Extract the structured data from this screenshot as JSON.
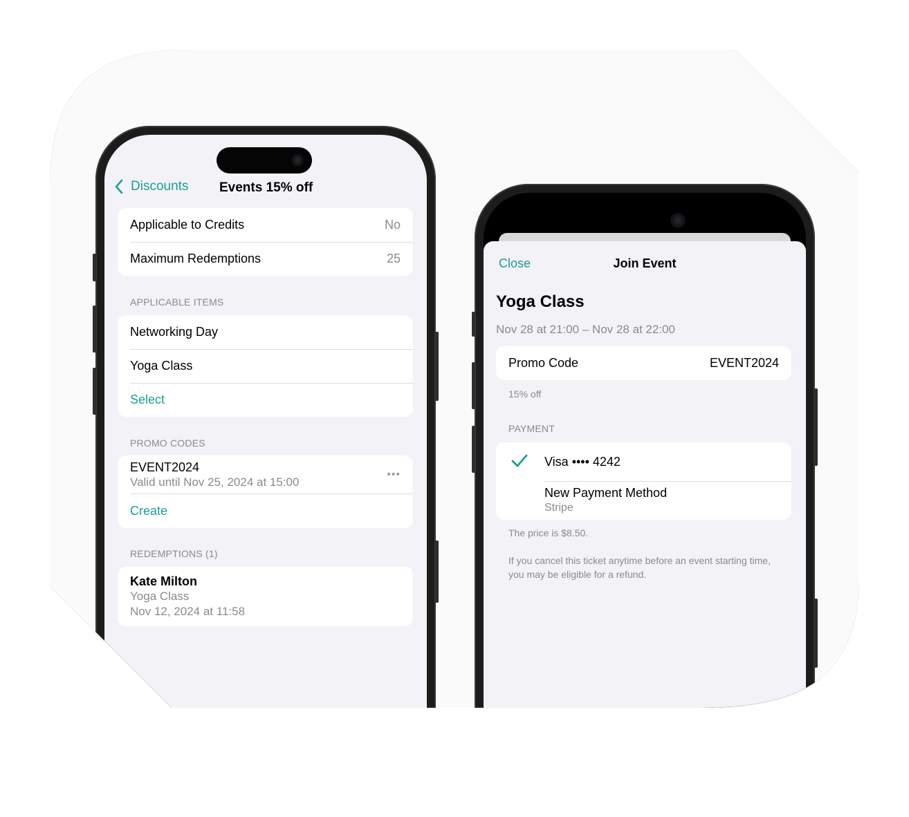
{
  "colors": {
    "accent": "#1a9e96",
    "background": "#f2f2f7",
    "secondary_text": "#8a8a8e"
  },
  "discount_screen": {
    "nav": {
      "back_label": "Discounts",
      "back_icon": "chevron-left-icon",
      "title": "Events 15% off"
    },
    "settings": [
      {
        "label": "Applicable to Credits",
        "value": "No"
      },
      {
        "label": "Maximum Redemptions",
        "value": "25"
      }
    ],
    "applicable_items": {
      "header": "APPLICABLE ITEMS",
      "items": [
        "Networking Day",
        "Yoga Class"
      ],
      "select_label": "Select"
    },
    "promo_codes": {
      "header": "PROMO CODES",
      "codes": [
        {
          "code": "EVENT2024",
          "validity": "Valid until Nov 25, 2024 at 15:00",
          "more_icon": "ellipsis-icon",
          "more_glyph": "•••"
        }
      ],
      "create_label": "Create"
    },
    "redemptions": {
      "header": "REDEMPTIONS (1)",
      "items": [
        {
          "name": "Kate Milton",
          "item": "Yoga Class",
          "date": "Nov 12, 2024 at 11:58"
        }
      ]
    }
  },
  "join_event_sheet": {
    "nav": {
      "close_label": "Close",
      "title": "Join Event"
    },
    "event": {
      "title": "Yoga Class",
      "time": "Nov 28 at 21:00 – Nov 28 at 22:00"
    },
    "promo": {
      "label": "Promo Code",
      "value": "EVENT2024",
      "footnote": "15% off"
    },
    "payment": {
      "header": "PAYMENT",
      "methods": [
        {
          "label": "Visa •••• 4242",
          "selected": true,
          "check_icon": "checkmark-icon"
        },
        {
          "label": "New Payment Method",
          "sublabel": "Stripe",
          "selected": false
        }
      ],
      "price_note": "The price is $8.50.",
      "refund_note": "If you cancel this ticket anytime before an event starting time, you may be eligible for a refund."
    }
  }
}
